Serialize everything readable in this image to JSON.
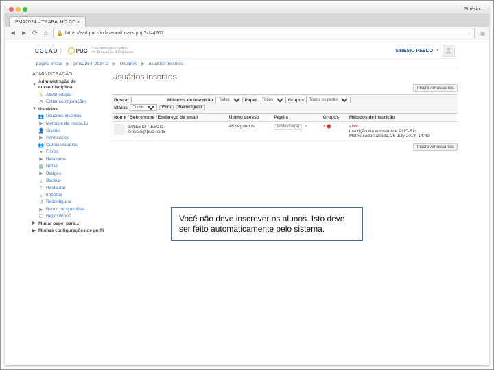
{
  "mac": {
    "user_label": "Sinésio ..."
  },
  "tab": {
    "title": "PMA2024 – TRABALHO CC ×"
  },
  "url": "https://ead.puc-rio.br/enrol/users.php?id=4267",
  "header": {
    "logo1": "CCEAD",
    "logo2_primary": "Coordenação Central",
    "logo2_secondary": "de Educação a Distância",
    "username": "SINESIO PESCO"
  },
  "breadcrumbs": [
    "página inicial",
    "pma2254_2014.2",
    "Usuários",
    "usuários inscritos"
  ],
  "sidebar": {
    "title": "ADMINISTRAÇÃO",
    "items": [
      {
        "label": "Administração do curso/disciplina",
        "hdr": true,
        "caret": "▼"
      },
      {
        "label": "Ativar edição",
        "icon": "✎",
        "color": "#d59a00"
      },
      {
        "label": "Editar configurações",
        "icon": "⚙",
        "color": "#888"
      },
      {
        "label": "Usuários",
        "hdr": true,
        "caret": "▼"
      },
      {
        "label": "Usuários inscritos",
        "icon": "👥",
        "color": "#5a7"
      },
      {
        "label": "Métodos de inscrição",
        "icon": "▶",
        "color": "#888"
      },
      {
        "label": "Grupos",
        "icon": "👤",
        "color": "#5a7"
      },
      {
        "label": "Permissões",
        "icon": "▶",
        "color": "#888"
      },
      {
        "label": "Outros usuários",
        "icon": "👥",
        "color": "#5a7"
      },
      {
        "label": "Filtros",
        "icon": "▼",
        "color": "#5aa"
      },
      {
        "label": "Relatórios",
        "icon": "▶",
        "color": "#888"
      },
      {
        "label": "Notas",
        "icon": "▦",
        "color": "#5aa"
      },
      {
        "label": "Badges",
        "icon": "▶",
        "color": "#888"
      },
      {
        "label": "Backup",
        "icon": "⤓",
        "color": "#5aa"
      },
      {
        "label": "Restaurar",
        "icon": "⤒",
        "color": "#5aa"
      },
      {
        "label": "Importar",
        "icon": "⤓",
        "color": "#5aa"
      },
      {
        "label": "Reconfigurar",
        "icon": "↺",
        "color": "#5aa"
      },
      {
        "label": "Banco de questões",
        "icon": "▶",
        "color": "#888"
      },
      {
        "label": "Repositórios",
        "icon": "☐",
        "color": "#888"
      },
      {
        "label": "Mudar papel para...",
        "hdr": true,
        "caret": "▶"
      },
      {
        "label": "Minhas configurações de perfil",
        "hdr": true,
        "caret": "▶"
      }
    ]
  },
  "main": {
    "title": "Usuários inscritos",
    "enroll_btn": "Inscrever usuários",
    "filters": {
      "search_lbl": "Buscar",
      "method_lbl": "Métodos de inscrição",
      "method_val": "Todos",
      "role_lbl": "Papel",
      "role_val": "Todos",
      "group_lbl": "Grupos",
      "group_val": "Todos os partici",
      "status_lbl": "Status",
      "status_val": "Todos",
      "filter_btn": "Filtro",
      "reset_btn": "Reconfigurar"
    },
    "table": {
      "cols": [
        "Nome / Sobrenome / Endereço de email",
        "Último acesso",
        "Papéis",
        "Grupos",
        "Métodos de inscrição"
      ],
      "row": {
        "name": "SINESIO PESCO",
        "email": "sinesio@puc-rio.br",
        "last": "46 segundos",
        "role": "Professor(a)",
        "enrol_line1": "ativo",
        "enrol_line2": "Inscrição via webservice PUC-Rio",
        "enrol_line3": "Matriculado sábado, 26 July 2014, 14:49"
      }
    }
  },
  "callout": {
    "text": "Você não deve inscrever os alunos. Isto deve ser feito automaticamente pelo sistema."
  }
}
